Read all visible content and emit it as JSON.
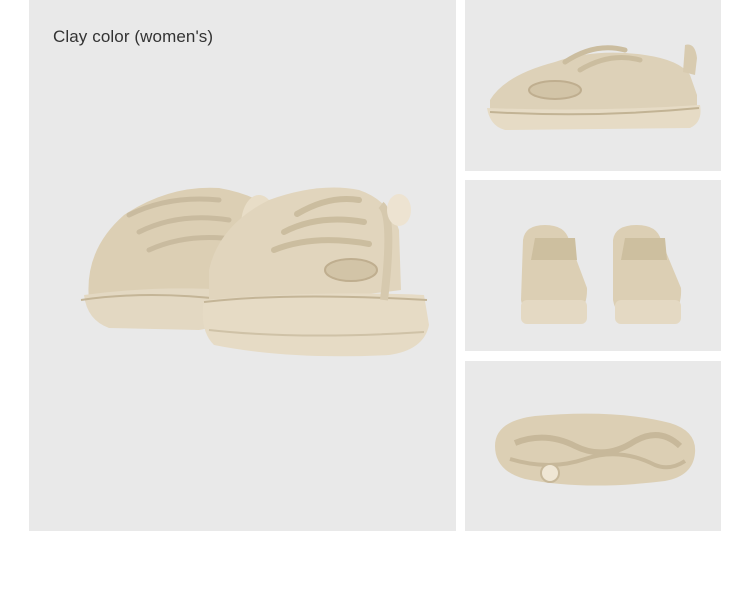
{
  "caption": "Clay color (women's)",
  "colors": {
    "background": "#ffffff",
    "panel": "#e9e9e9",
    "shoe_main": "#e1d5bd",
    "shoe_shadow": "#c9bb9f",
    "shoe_dark": "#b9aa8b",
    "shoe_light": "#efe6d4",
    "caption_text": "#333333"
  },
  "images": [
    {
      "view": "pair-three-quarter"
    },
    {
      "view": "side-profile"
    },
    {
      "view": "rear-pair"
    },
    {
      "view": "outsole"
    }
  ]
}
